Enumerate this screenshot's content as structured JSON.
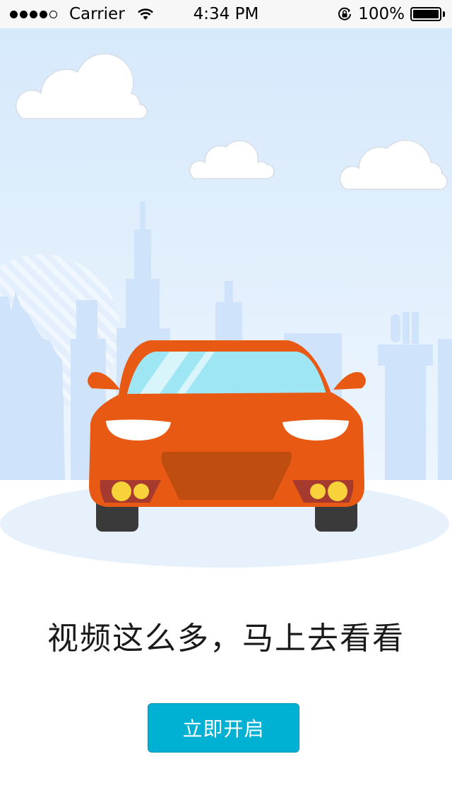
{
  "status_bar": {
    "carrier": "Carrier",
    "time": "4:34 PM",
    "battery_percent": "100%",
    "signal_bars_filled": 4,
    "signal_bars_total": 5
  },
  "onboarding": {
    "slogan": "视频这么多，马上去看看",
    "start_button_label": "立即开启"
  },
  "colors": {
    "sky": "#dcecfb",
    "skyline": "#cfe4fb",
    "car_body": "#e85a14",
    "windshield": "#9fe6f5",
    "grille": "#bf4d10",
    "headlight": "#f7d23a",
    "tire": "#3a3a3a",
    "button": "#00b1d4"
  },
  "icons": {
    "wifi": "wifi-icon",
    "rotation_lock": "rotation-lock-icon",
    "battery": "battery-icon"
  }
}
